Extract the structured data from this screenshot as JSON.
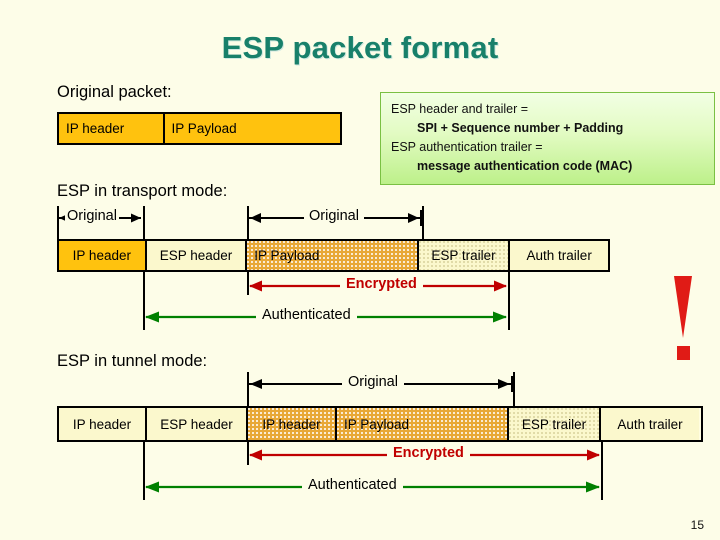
{
  "slide": {
    "title": "ESP packet format",
    "page_number": "15",
    "warning_icon": "exclamation-mark"
  },
  "original_packet": {
    "heading": "Original packet:",
    "cells": [
      {
        "label": "IP header",
        "fill": "gold"
      },
      {
        "label": "IP Payload",
        "fill": "gold"
      }
    ]
  },
  "callout": {
    "lines": [
      "ESP header and trailer =",
      "SPI + Sequence number + Padding",
      "ESP authentication trailer =",
      "message authentication code (MAC)"
    ],
    "border_color": "#7ac043",
    "fill_color": "#bdf08a"
  },
  "transport_mode": {
    "heading": "ESP in transport mode:",
    "cells": [
      {
        "label": "IP header",
        "fill": "gold"
      },
      {
        "label": "ESP header",
        "fill": "cream"
      },
      {
        "label": "IP Payload",
        "fill": "dotted-orange"
      },
      {
        "label": "ESP trailer",
        "fill": "dotted-cream"
      },
      {
        "label": "Auth trailer",
        "fill": "cream"
      }
    ],
    "top_measures": [
      {
        "label": "Original",
        "style": "black"
      },
      {
        "label": "Original",
        "style": "black"
      }
    ],
    "bottom_measures": [
      {
        "label": "Encrypted",
        "style": "red",
        "color": "#c00000"
      },
      {
        "label": "Authenticated",
        "style": "green",
        "color": "#008000"
      }
    ]
  },
  "tunnel_mode": {
    "heading": "ESP in tunnel mode:",
    "cells": [
      {
        "label": "IP header",
        "fill": "cream"
      },
      {
        "label": "ESP header",
        "fill": "cream"
      },
      {
        "label": "IP header",
        "fill": "dotted-orange"
      },
      {
        "label": "IP Payload",
        "fill": "dotted-orange"
      },
      {
        "label": "ESP trailer",
        "fill": "dotted-cream"
      },
      {
        "label": "Auth trailer",
        "fill": "cream"
      }
    ],
    "top_measures": [
      {
        "label": "Original",
        "style": "black"
      }
    ],
    "bottom_measures": [
      {
        "label": "Encrypted",
        "style": "red",
        "color": "#c00000"
      },
      {
        "label": "Authenticated",
        "style": "green",
        "color": "#008000"
      }
    ]
  }
}
